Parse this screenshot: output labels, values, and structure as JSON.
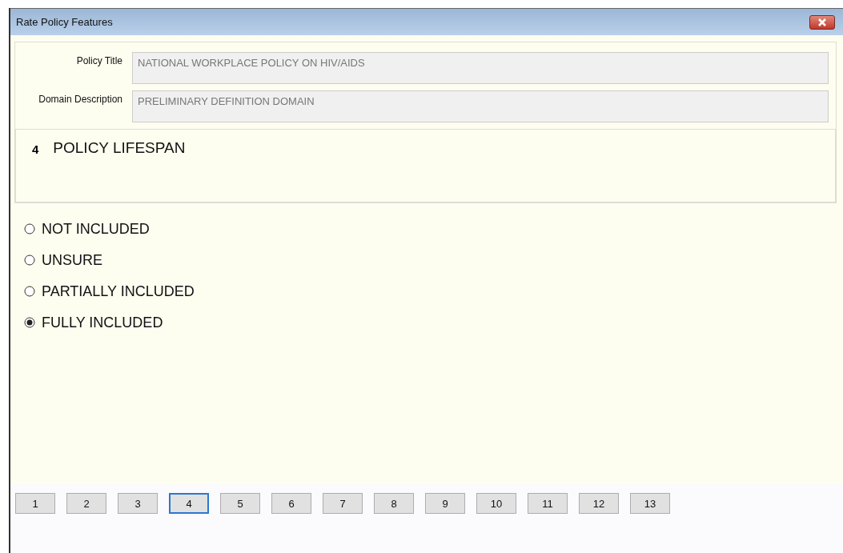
{
  "window": {
    "title": "Rate Policy Features"
  },
  "fields": [
    {
      "label": "Policy Title",
      "value": "NATIONAL WORKPLACE POLICY ON HIV/AIDS"
    },
    {
      "label": "Domain Description",
      "value": "PRELIMINARY DEFINITION DOMAIN"
    }
  ],
  "question": {
    "number": "4",
    "text": "POLICY LIFESPAN"
  },
  "options": [
    {
      "label": "NOT INCLUDED",
      "selected": false
    },
    {
      "label": "UNSURE",
      "selected": false
    },
    {
      "label": "PARTIALLY INCLUDED",
      "selected": false
    },
    {
      "label": "FULLY INCLUDED",
      "selected": true
    }
  ],
  "pages": [
    {
      "label": "1",
      "selected": false
    },
    {
      "label": "2",
      "selected": false
    },
    {
      "label": "3",
      "selected": false
    },
    {
      "label": "4",
      "selected": true
    },
    {
      "label": "5",
      "selected": false
    },
    {
      "label": "6",
      "selected": false
    },
    {
      "label": "7",
      "selected": false
    },
    {
      "label": "8",
      "selected": false
    },
    {
      "label": "9",
      "selected": false
    },
    {
      "label": "10",
      "selected": false
    },
    {
      "label": "11",
      "selected": false
    },
    {
      "label": "12",
      "selected": false
    },
    {
      "label": "13",
      "selected": false
    }
  ]
}
